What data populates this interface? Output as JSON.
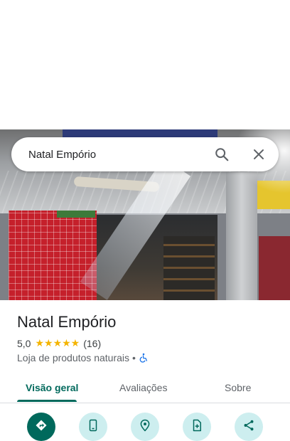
{
  "search": {
    "query": "Natal Empório"
  },
  "place": {
    "name": "Natal Empório",
    "rating": "5,0",
    "stars": "★★★★★",
    "review_count": "(16)",
    "category": "Loja de produtos naturais",
    "separator": "•"
  },
  "tabs": [
    {
      "label": "Visão geral",
      "active": true
    },
    {
      "label": "Avaliações",
      "active": false
    },
    {
      "label": "Sobre",
      "active": false
    }
  ],
  "actions": [
    {
      "icon": "directions-icon"
    },
    {
      "icon": "phone-icon"
    },
    {
      "icon": "location-pin-icon"
    },
    {
      "icon": "save-doc-icon"
    },
    {
      "icon": "share-icon"
    }
  ],
  "colors": {
    "accent": "#00695c",
    "action_secondary_bg": "#cdeeef",
    "star": "#f4b400"
  }
}
